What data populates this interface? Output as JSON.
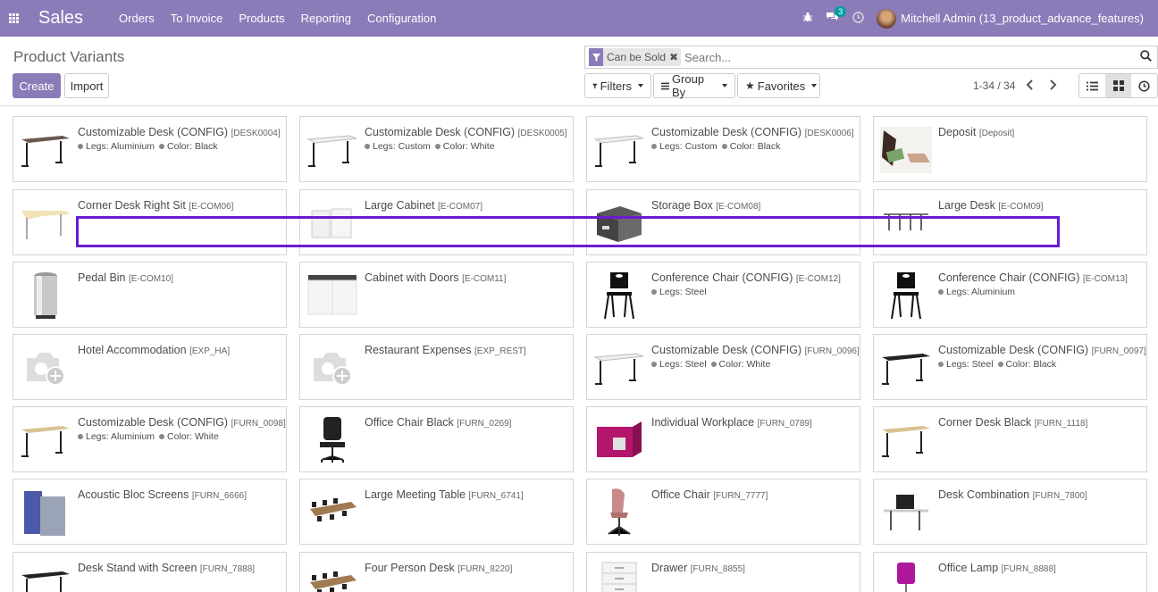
{
  "navbar": {
    "brand": "Sales",
    "menu": [
      "Orders",
      "To Invoice",
      "Products",
      "Reporting",
      "Configuration"
    ],
    "messages_count": "3",
    "user": "Mitchell Admin (13_product_advance_features)"
  },
  "control_panel": {
    "title": "Product Variants",
    "create_label": "Create",
    "import_label": "Import",
    "facet_label": "Can be Sold",
    "search_placeholder": "Search...",
    "filters_label": "Filters",
    "groupby_label": "Group By",
    "favorites_label": "Favorites",
    "pager": "1-34 / 34"
  },
  "cards": [
    {
      "name": "Customizable Desk (CONFIG)",
      "code": "[DESK0004]",
      "attrs": [
        "Legs: Aluminium",
        "Color: Black"
      ],
      "thumb": "desk-dark"
    },
    {
      "name": "Customizable Desk (CONFIG)",
      "code": "[DESK0005]",
      "attrs": [
        "Legs: Custom",
        "Color: White"
      ],
      "thumb": "desk-white"
    },
    {
      "name": "Customizable Desk (CONFIG)",
      "code": "[DESK0006]",
      "attrs": [
        "Legs: Custom",
        "Color: Black"
      ],
      "thumb": "desk-white"
    },
    {
      "name": "Deposit",
      "code": "[Deposit]",
      "attrs": [],
      "thumb": "money"
    },
    {
      "name": "Corner Desk Right Sit",
      "code": "[E-COM06]",
      "attrs": [],
      "thumb": "desk-corner"
    },
    {
      "name": "Large Cabinet",
      "code": "[E-COM07]",
      "attrs": [],
      "thumb": "cabinet-white"
    },
    {
      "name": "Storage Box",
      "code": "[E-COM08]",
      "attrs": [],
      "thumb": "box"
    },
    {
      "name": "Large Desk",
      "code": "[E-COM09]",
      "attrs": [],
      "thumb": "desk-large"
    },
    {
      "name": "Pedal Bin",
      "code": "[E-COM10]",
      "attrs": [],
      "thumb": "bin"
    },
    {
      "name": "Cabinet with Doors",
      "code": "[E-COM11]",
      "attrs": [],
      "thumb": "cabinet"
    },
    {
      "name": "Conference Chair (CONFIG)",
      "code": "[E-COM12]",
      "attrs": [
        "Legs: Steel"
      ],
      "thumb": "chair-black"
    },
    {
      "name": "Conference Chair (CONFIG)",
      "code": "[E-COM13]",
      "attrs": [
        "Legs: Aluminium"
      ],
      "thumb": "chair-black"
    },
    {
      "name": "Hotel Accommodation",
      "code": "[EXP_HA]",
      "attrs": [],
      "thumb": "placeholder"
    },
    {
      "name": "Restaurant Expenses",
      "code": "[EXP_REST]",
      "attrs": [],
      "thumb": "placeholder"
    },
    {
      "name": "Customizable Desk (CONFIG)",
      "code": "[FURN_0096]",
      "attrs": [
        "Legs: Steel",
        "Color: White"
      ],
      "thumb": "desk-white"
    },
    {
      "name": "Customizable Desk (CONFIG)",
      "code": "[FURN_0097]",
      "attrs": [
        "Legs: Steel",
        "Color: Black"
      ],
      "thumb": "desk-black"
    },
    {
      "name": "Customizable Desk (CONFIG)",
      "code": "[FURN_0098]",
      "attrs": [
        "Legs: Aluminium",
        "Color: White"
      ],
      "thumb": "desk-wood"
    },
    {
      "name": "Office Chair Black",
      "code": "[FURN_0269]",
      "attrs": [],
      "thumb": "office-chair"
    },
    {
      "name": "Individual Workplace",
      "code": "[FURN_0789]",
      "attrs": [],
      "thumb": "pod"
    },
    {
      "name": "Corner Desk Black",
      "code": "[FURN_1118]",
      "attrs": [],
      "thumb": "desk-wood"
    },
    {
      "name": "Acoustic Bloc Screens",
      "code": "[FURN_6666]",
      "attrs": [],
      "thumb": "screens"
    },
    {
      "name": "Large Meeting Table",
      "code": "[FURN_6741]",
      "attrs": [],
      "thumb": "meeting"
    },
    {
      "name": "Office Chair",
      "code": "[FURN_7777]",
      "attrs": [],
      "thumb": "pink-chair"
    },
    {
      "name": "Desk Combination",
      "code": "[FURN_7800]",
      "attrs": [],
      "thumb": "desk-combo"
    },
    {
      "name": "Desk Stand with Screen",
      "code": "[FURN_7888]",
      "attrs": [],
      "thumb": "desk-black"
    },
    {
      "name": "Four Person Desk",
      "code": "[FURN_8220]",
      "attrs": [],
      "thumb": "meeting"
    },
    {
      "name": "Drawer",
      "code": "[FURN_8855]",
      "attrs": [],
      "thumb": "drawer"
    },
    {
      "name": "Office Lamp",
      "code": "[FURN_8888]",
      "attrs": [],
      "thumb": "lamp"
    }
  ]
}
